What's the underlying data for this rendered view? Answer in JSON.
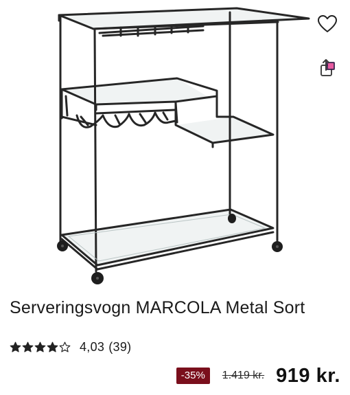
{
  "product": {
    "title": "Serveringsvogn MARCOLA Metal Sort",
    "rating": {
      "value": 4.03,
      "value_label": "4,03",
      "count_label": "(39)",
      "max_stars": 5
    },
    "price": {
      "discount_label": "-35%",
      "old_price": "1.419 kr.",
      "current_price": "919 kr."
    }
  },
  "actions": {
    "favorite_icon": "heart-outline-icon",
    "share_icon": "share-icon"
  },
  "colors": {
    "discount_badge": "#7a0f1c",
    "frame": "#262626",
    "text": "#1a1a1a"
  }
}
